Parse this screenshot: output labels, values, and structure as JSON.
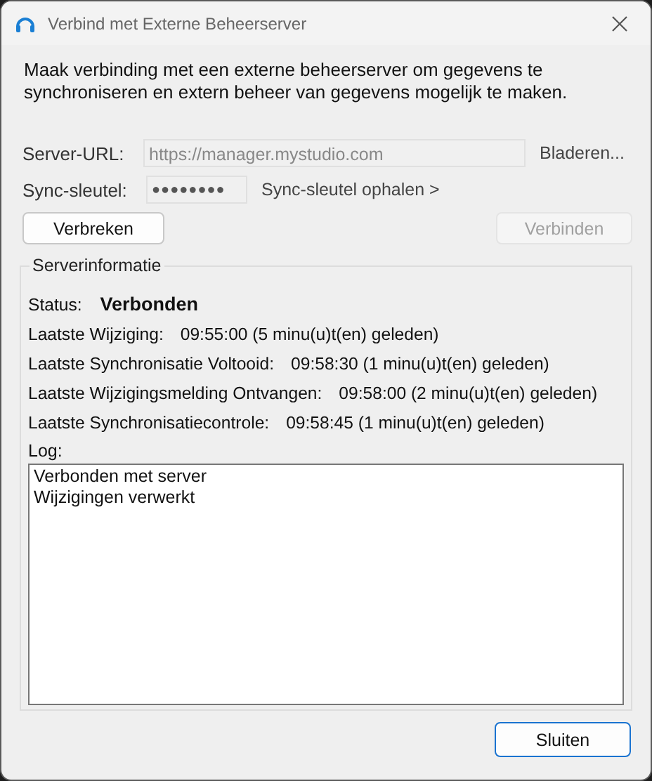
{
  "window": {
    "title": "Verbind met Externe Beheerserver"
  },
  "intro": "Maak verbinding met een externe beheerserver om gegevens te synchroniseren en extern beheer van gegevens mogelijk te maken.",
  "server_url": {
    "label": "Server-URL:",
    "value": "https://manager.mystudio.com",
    "disabled": true
  },
  "browse_link": "Bladeren...",
  "sync_key": {
    "label": "Sync-sleutel:",
    "value": "●●●●●●●●"
  },
  "get_key_link": "Sync-sleutel ophalen >",
  "buttons": [
    {
      "label": "Verbreken",
      "disabled": false
    },
    {
      "label": "Verbinden",
      "disabled": true
    }
  ],
  "server_info": {
    "title": "Serverinformatie",
    "status": {
      "label": "Status:",
      "value": "Verbonden"
    },
    "rows": [
      {
        "label": "Laatste Wijziging:",
        "value": "09:55:00 (5 minu(u)t(en) geleden)"
      },
      {
        "label": "Laatste Synchronisatie Voltooid:",
        "value": "09:58:30 (1 minu(u)t(en) geleden)"
      },
      {
        "label": "Laatste Wijzigingsmelding Ontvangen:",
        "value": "09:58:00 (2 minu(u)t(en) geleden)"
      },
      {
        "label": "Laatste Synchronisatiecontrole:",
        "value": "09:58:45 (1 minu(u)t(en) geleden)"
      }
    ],
    "log": {
      "label": "Log:",
      "lines": [
        "Verbonden met server",
        "Wijzigingen verwerkt"
      ]
    }
  },
  "footer_buttons": [
    {
      "label": "Sluiten",
      "default": true
    }
  ]
}
